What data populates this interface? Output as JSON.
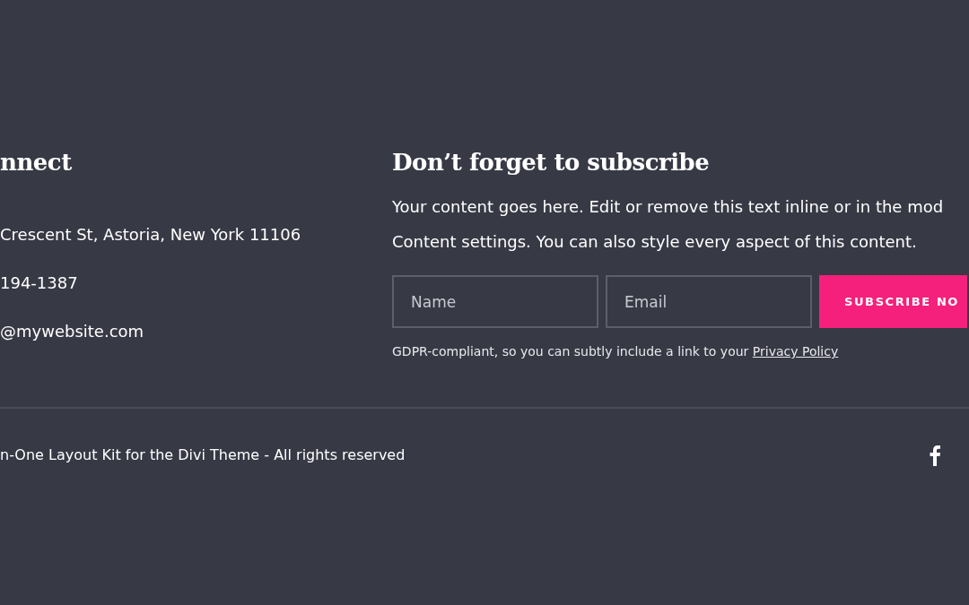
{
  "contact": {
    "heading": "nnect",
    "items": [
      {
        "kind": "address",
        "text": "Crescent St, Astoria, New York 11106"
      },
      {
        "kind": "phone",
        "text": "194-1387"
      },
      {
        "kind": "email",
        "text": "@mywebsite.com"
      }
    ]
  },
  "subscribe": {
    "heading": "Don’t forget to subscribe",
    "description_lines": [
      "Your content goes here. Edit or remove this text inline or in the mod",
      "Content settings. You can also style every aspect of this content."
    ],
    "fields": [
      {
        "placeholder": "Name"
      },
      {
        "placeholder": "Email"
      }
    ],
    "button": "SUBSCRIBE NO",
    "note": "GDPR-compliant, so you can subtly include a link to your ",
    "note_link": "Privacy Policy"
  },
  "footer": {
    "copyright": "n-One Layout Kit for the Divi Theme - All rights reserved",
    "social": [
      {
        "kind": "facebook"
      }
    ]
  }
}
